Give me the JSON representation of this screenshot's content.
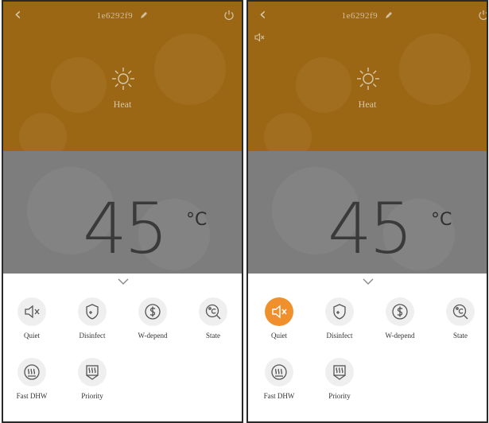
{
  "phones": [
    {
      "header": {
        "title": "1e6292f9"
      },
      "mode": {
        "label": "Heat",
        "icon": "sun-icon"
      },
      "temperature": {
        "value": "45",
        "unit": "°C"
      },
      "functions": [
        {
          "label": "Quiet",
          "icon": "speaker-mute-icon",
          "active": false
        },
        {
          "label": "Disinfect",
          "icon": "shield-plus-icon",
          "active": false
        },
        {
          "label": "W-depend",
          "icon": "dollar-icon",
          "active": false
        },
        {
          "label": "State",
          "icon": "celsius-search-icon",
          "active": false
        },
        {
          "label": "Fast DHW",
          "icon": "fast-water-icon",
          "active": false
        },
        {
          "label": "Priority",
          "icon": "priority-water-icon",
          "active": false
        }
      ]
    },
    {
      "header": {
        "title": "1e6292f9"
      },
      "mode": {
        "label": "Heat",
        "icon": "sun-icon"
      },
      "temperature": {
        "value": "45",
        "unit": "°C"
      },
      "functions": [
        {
          "label": "Quiet",
          "icon": "speaker-mute-icon",
          "active": true
        },
        {
          "label": "Disinfect",
          "icon": "shield-plus-icon",
          "active": false
        },
        {
          "label": "W-depend",
          "icon": "dollar-icon",
          "active": false
        },
        {
          "label": "State",
          "icon": "celsius-search-icon",
          "active": false
        },
        {
          "label": "Fast DHW",
          "icon": "fast-water-icon",
          "active": false
        },
        {
          "label": "Priority",
          "icon": "priority-water-icon",
          "active": false
        }
      ]
    }
  ],
  "colors": {
    "accent": "#f0902c",
    "top_bg": "#9c6714",
    "mid_bg": "#7d7d7d"
  }
}
